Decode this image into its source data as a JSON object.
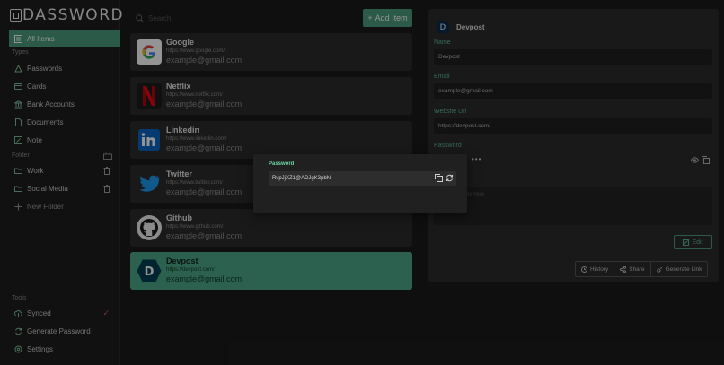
{
  "brand": {
    "logo_text": "DASSWORD"
  },
  "sidebar": {
    "all_items": "All Items",
    "types_label": "Types",
    "types": [
      "Passwords",
      "Cards",
      "Bank Accounts",
      "Documents",
      "Note"
    ],
    "folder_label": "Folder",
    "folders": [
      "Work",
      "Social Media"
    ],
    "new_folder": "New Folder",
    "tools_label": "Tools",
    "tools": [
      "Synced",
      "Generate Password",
      "Settings"
    ]
  },
  "search": {
    "placeholder": "Search"
  },
  "add_item": "Add Item",
  "items": [
    {
      "name": "Google",
      "url": "https://www.google.com/",
      "email": "example@gmail.com"
    },
    {
      "name": "Netflix",
      "url": "https://www.netflix.com/",
      "email": "example@gmail.com"
    },
    {
      "name": "Linkedin",
      "url": "https://www.linkedin.com/",
      "email": "example@gmail.com"
    },
    {
      "name": "Twitter",
      "url": "https://www.twitter.com/",
      "email": "example@gmail.com"
    },
    {
      "name": "Github",
      "url": "https://www.github.com/",
      "email": "example@gmail.com"
    },
    {
      "name": "Devpost",
      "url": "https://devpost.com/",
      "email": "example@gmail.com"
    }
  ],
  "detail": {
    "avatar_letter": "D",
    "title": "Devpost",
    "name_label": "Name",
    "name_value": "Devpost",
    "email_label": "Email",
    "email_value": "example@gmail.com",
    "website_label": "Website Url",
    "website_value": "https://devpost.com/",
    "password_label": "Password",
    "password_mask": "•••",
    "notes_placeholder": "Note here",
    "edit": "Edit",
    "actions": [
      "History",
      "Share",
      "Generate Link"
    ]
  },
  "popup": {
    "label": "Password",
    "value": "RvpJjXZ1@ADJgK3pbN"
  },
  "colors": {
    "accent": "#4a9b7d",
    "active_card": "#4da888",
    "synced_check": "#e0535e",
    "netflix": "#e50914",
    "linkedin": "#0a66c2",
    "twitter": "#1d9bf0"
  }
}
